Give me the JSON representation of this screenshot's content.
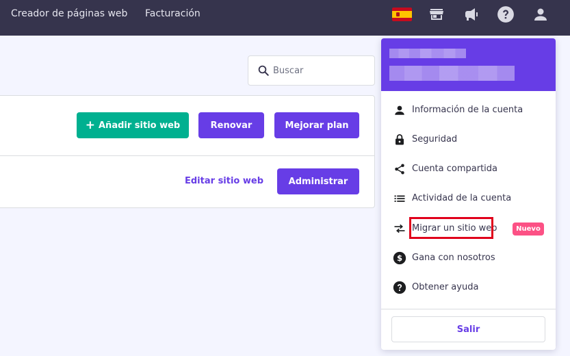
{
  "nav": {
    "links": [
      "Creador de páginas web",
      "Facturación"
    ]
  },
  "top_icons": [
    "spain-flag-icon",
    "store-icon",
    "megaphone-icon",
    "help-icon",
    "user-icon"
  ],
  "search": {
    "placeholder": "Buscar",
    "value": ""
  },
  "toolbar": {
    "add_site_label": "Añadir sitio web",
    "renew_label": "Renovar",
    "upgrade_label": "Mejorar plan"
  },
  "website_row": {
    "edit_label": "Editar sitio web",
    "manage_label": "Administrar"
  },
  "dropdown": {
    "items": [
      {
        "label": "Información de la cuenta",
        "icon": "person-icon"
      },
      {
        "label": "Seguridad",
        "icon": "lock-icon"
      },
      {
        "label": "Cuenta compartida",
        "icon": "share-icon"
      },
      {
        "label": "Actividad de la cuenta",
        "icon": "list-icon"
      },
      {
        "label": "Migrar un sitio web",
        "icon": "migrate-arrows-icon"
      },
      {
        "label": "Gana con nosotros",
        "icon": "dollar-icon"
      },
      {
        "label": "Obtener ayuda",
        "icon": "help-icon"
      }
    ],
    "new_badge": "Nuevo",
    "logout_label": "Salir"
  },
  "colors": {
    "topbar": "#36344d",
    "accent_purple": "#673de6",
    "accent_green": "#00b090",
    "badge_pink": "#fc5185",
    "highlight_red": "#e0001b",
    "page_background": "#f4f5ff"
  }
}
